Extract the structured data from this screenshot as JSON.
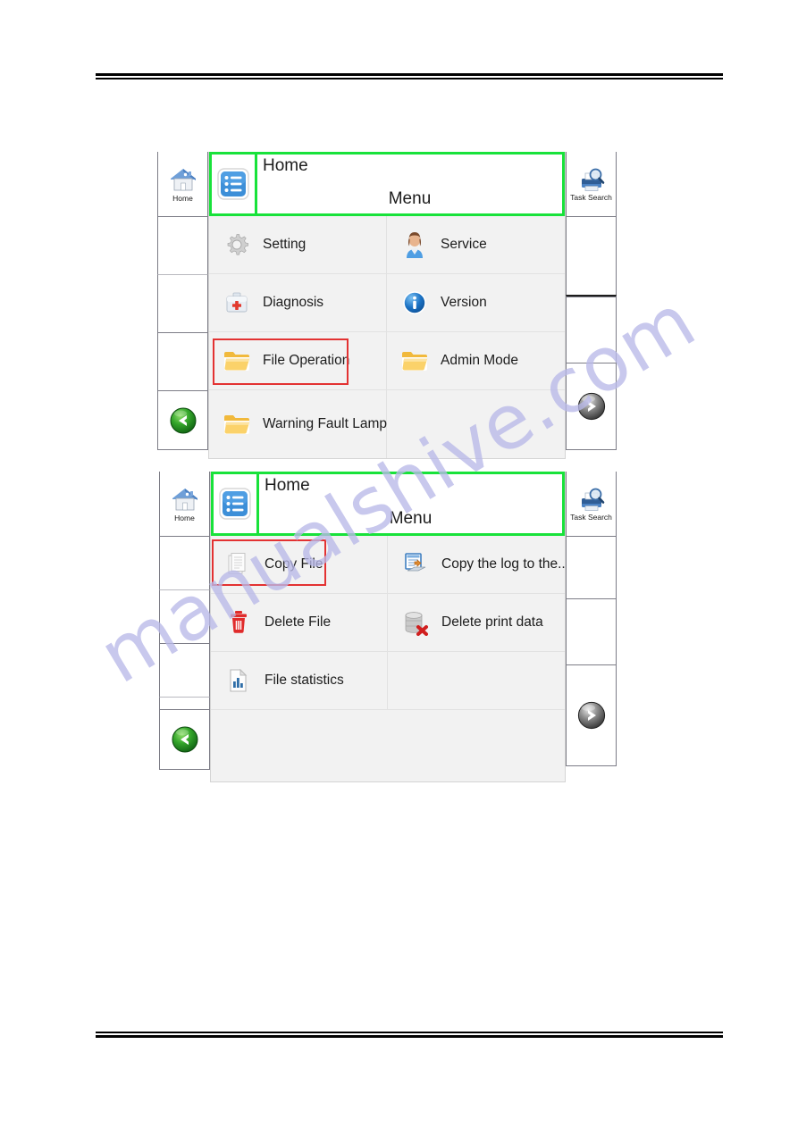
{
  "watermark": {
    "text": "manualshive.com",
    "color": "#b9b9e8"
  },
  "accents": {
    "selection_green": "#18e23a",
    "callout_red": "#e33232",
    "screen_bg": "#f2f2f2",
    "rail_border": "#7c7c86"
  },
  "panels": [
    {
      "id": "menu-root",
      "rail_left": {
        "home_icon": "home-icon",
        "home_label": "Home",
        "back_icon": "back-arrow-icon"
      },
      "rail_right": {
        "task_search_icon": "task-search-icon",
        "task_search_label": "Task Search",
        "forward_icon": "forward-arrow-icon"
      },
      "titlebar": {
        "menu_icon": "list-menu-icon",
        "home_text": "Home",
        "menu_text": "Menu"
      },
      "items": [
        {
          "label": "Setting",
          "icon": "gear-icon",
          "selected": false
        },
        {
          "label": "Service",
          "icon": "person-icon",
          "selected": false
        },
        {
          "label": "Diagnosis",
          "icon": "first-aid-icon",
          "selected": false
        },
        {
          "label": "Version",
          "icon": "info-icon",
          "selected": false
        },
        {
          "label": "File Operation",
          "icon": "folder-icon",
          "selected": true
        },
        {
          "label": "Admin Mode",
          "icon": "folder-icon",
          "selected": false
        },
        {
          "label": "Warning Fault Lamp",
          "icon": "folder-icon",
          "selected": false
        }
      ]
    },
    {
      "id": "file-operation",
      "rail_left": {
        "home_icon": "home-icon",
        "home_label": "Home",
        "back_icon": "back-arrow-icon"
      },
      "rail_right": {
        "task_search_icon": "task-search-icon",
        "task_search_label": "Task Search",
        "forward_icon": "forward-arrow-icon"
      },
      "titlebar": {
        "menu_icon": "list-menu-icon",
        "home_text": "Home",
        "menu_text": "Menu"
      },
      "items": [
        {
          "label": "Copy File",
          "icon": "document-icon",
          "selected": true
        },
        {
          "label": "Copy the log to the...",
          "icon": "copy-log-icon",
          "selected": false
        },
        {
          "label": "Delete File",
          "icon": "trash-icon",
          "selected": false
        },
        {
          "label": "Delete print data",
          "icon": "database-delete-icon",
          "selected": false
        },
        {
          "label": "File statistics",
          "icon": "bar-chart-file-icon",
          "selected": false
        }
      ]
    }
  ]
}
